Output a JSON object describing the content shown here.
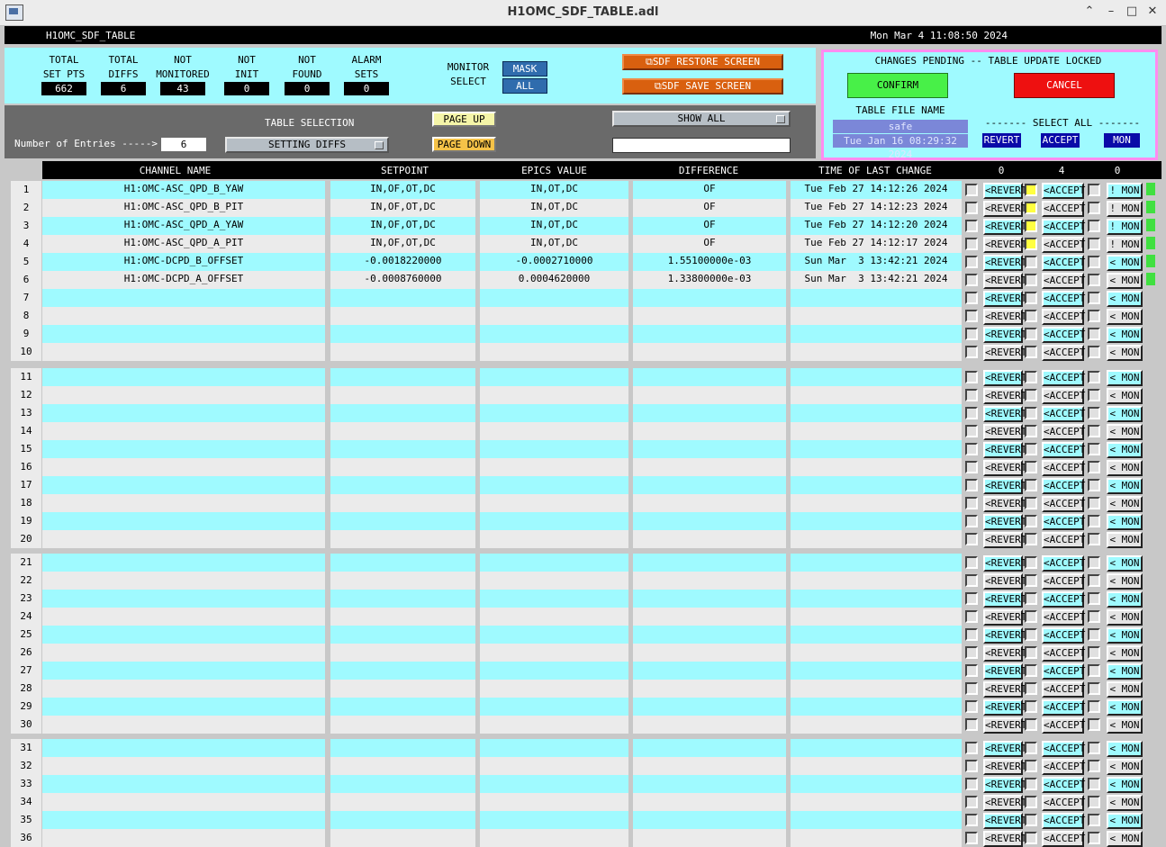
{
  "window": {
    "title": "H1OMC_SDF_TABLE.adl"
  },
  "header": {
    "name": "H1OMC_SDF_TABLE",
    "datetime": "Mon Mar  4 11:08:50 2024"
  },
  "stats": [
    {
      "label1": "TOTAL",
      "label2": "SET PTS",
      "value": "662"
    },
    {
      "label1": "TOTAL",
      "label2": "DIFFS",
      "value": "6"
    },
    {
      "label1": "NOT",
      "label2": "MONITORED",
      "value": "43"
    },
    {
      "label1": "NOT",
      "label2": "INIT",
      "value": "0"
    },
    {
      "label1": "NOT",
      "label2": "FOUND",
      "value": "0"
    },
    {
      "label1": "ALARM",
      "label2": "SETS",
      "value": "0"
    }
  ],
  "monitor_select": {
    "label1": "MONITOR",
    "label2": "SELECT",
    "mask": "MASK",
    "all": "ALL"
  },
  "screens": {
    "restore": "SDF RESTORE SCREEN",
    "save": "SDF SAVE SCREEN"
  },
  "selection": {
    "table_selection_label": "TABLE SELECTION",
    "table_selection_value": "SETTING DIFFS",
    "entries_label": "Number of Entries ----->",
    "entries_value": "6",
    "page_up": "PAGE UP",
    "page_down": "PAGE DOWN",
    "show_all": "SHOW ALL",
    "filter_value": ""
  },
  "confirm_panel": {
    "status": "CHANGES PENDING -- TABLE UPDATE LOCKED",
    "confirm": "CONFIRM",
    "cancel": "CANCEL",
    "table_file_label": "TABLE FILE NAME",
    "table_file_name": "safe",
    "table_file_date": "Tue Jan 16 08:29:32 2024",
    "select_all_label": "------- SELECT ALL -------",
    "revert_all": "REVERT",
    "accept_all": "ACCEPT",
    "mon_all": "MON"
  },
  "columns": {
    "channel": "CHANNEL NAME",
    "setpoint": "SETPOINT",
    "epics": "EPICS VALUE",
    "difference": "DIFFERENCE",
    "time": "TIME OF LAST CHANGE",
    "count_revert": "0",
    "count_accept": "4",
    "count_mon": "0"
  },
  "row_labels": {
    "revert": "<REVERT",
    "accept": "<ACCEPT",
    "mon_lt": "< MON",
    "mon_bang": "! MON"
  },
  "rows": [
    {
      "n": "1",
      "channel": "H1:OMC-ASC_QPD_B_YAW",
      "setpoint": "IN,OF,OT,DC",
      "epics": "IN,OT,DC",
      "diff": "OF",
      "time": "Tue Feb 27 14:12:26 2024",
      "accept": true,
      "mon": "bang",
      "led": true
    },
    {
      "n": "2",
      "channel": "H1:OMC-ASC_QPD_B_PIT",
      "setpoint": "IN,OF,OT,DC",
      "epics": "IN,OT,DC",
      "diff": "OF",
      "time": "Tue Feb 27 14:12:23 2024",
      "accept": true,
      "mon": "bang",
      "led": true
    },
    {
      "n": "3",
      "channel": "H1:OMC-ASC_QPD_A_YAW",
      "setpoint": "IN,OF,OT,DC",
      "epics": "IN,OT,DC",
      "diff": "OF",
      "time": "Tue Feb 27 14:12:20 2024",
      "accept": true,
      "mon": "bang",
      "led": true
    },
    {
      "n": "4",
      "channel": "H1:OMC-ASC_QPD_A_PIT",
      "setpoint": "IN,OF,OT,DC",
      "epics": "IN,OT,DC",
      "diff": "OF",
      "time": "Tue Feb 27 14:12:17 2024",
      "accept": true,
      "mon": "bang",
      "led": true
    },
    {
      "n": "5",
      "channel": "H1:OMC-DCPD_B_OFFSET",
      "setpoint": "-0.0018220000",
      "epics": "-0.0002710000",
      "diff": "1.55100000e-03",
      "time": "Sun Mar  3 13:42:21 2024",
      "accept": false,
      "mon": "lt",
      "led": true
    },
    {
      "n": "6",
      "channel": "H1:OMC-DCPD_A_OFFSET",
      "setpoint": "-0.0008760000",
      "epics": "0.0004620000",
      "diff": "1.33800000e-03",
      "time": "Sun Mar  3 13:42:21 2024",
      "accept": false,
      "mon": "lt",
      "led": true
    },
    {
      "n": "7"
    },
    {
      "n": "8"
    },
    {
      "n": "9"
    },
    {
      "n": "10"
    },
    {
      "n": "11"
    },
    {
      "n": "12"
    },
    {
      "n": "13"
    },
    {
      "n": "14"
    },
    {
      "n": "15"
    },
    {
      "n": "16"
    },
    {
      "n": "17"
    },
    {
      "n": "18"
    },
    {
      "n": "19"
    },
    {
      "n": "20"
    },
    {
      "n": "21"
    },
    {
      "n": "22"
    },
    {
      "n": "23"
    },
    {
      "n": "24"
    },
    {
      "n": "25"
    },
    {
      "n": "26"
    },
    {
      "n": "27"
    },
    {
      "n": "28"
    },
    {
      "n": "29"
    },
    {
      "n": "30"
    },
    {
      "n": "31"
    },
    {
      "n": "32"
    },
    {
      "n": "33"
    },
    {
      "n": "34"
    },
    {
      "n": "35"
    },
    {
      "n": "36"
    }
  ],
  "colors": {
    "cyan": "#9ffaff",
    "gray": "#ebebeb",
    "orange": "#d9600f",
    "green": "#48f048",
    "red": "#ee1010",
    "navy": "#0a0aa8"
  }
}
